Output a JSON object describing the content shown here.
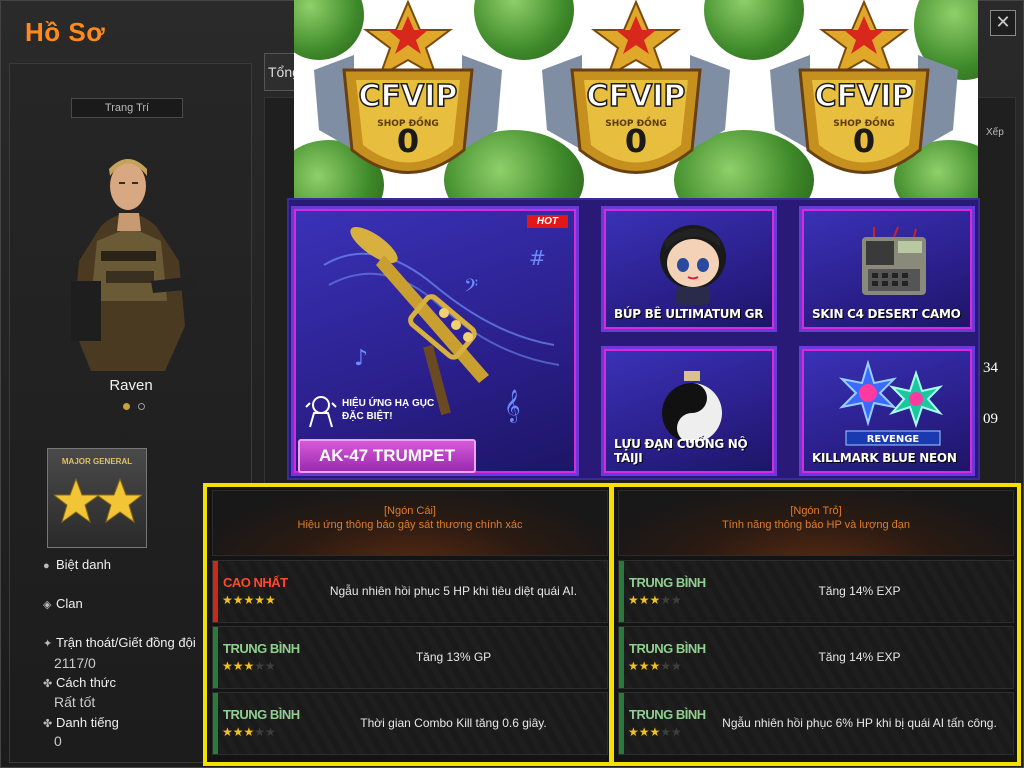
{
  "window": {
    "title": "Hồ Sơ",
    "close_icon": "close-icon"
  },
  "profile": {
    "decor_label": "Trang Trí",
    "name": "Raven",
    "rank": "MAJOR GENERAL",
    "stats": [
      {
        "label": "Biệt danh",
        "value": "",
        "icon": "person-icon"
      },
      {
        "label": "Clan",
        "value": "",
        "icon": "shield-icon"
      },
      {
        "label": "Trận thoát/Giết đồng đội",
        "value": "2117/0",
        "icon": "running-icon"
      },
      {
        "label": "Cách thức",
        "value": "Rất tốt",
        "icon": "clover-icon"
      },
      {
        "label": "Danh tiếng",
        "value": "0",
        "icon": "clover-icon"
      }
    ]
  },
  "tabs": {
    "tong": "Tổng"
  },
  "side": {
    "xep": "Xếp",
    "num1": "34",
    "num2": "09"
  },
  "vip": {
    "badge_text": "CFVIP",
    "badge_number": "0",
    "ribbon": "SHOP ĐỒNG"
  },
  "shop": {
    "hot": "HOT",
    "main_item": "AK-47 TRUMPET",
    "effect": "HIỆU ỨNG HẠ GỤC\nĐẶC BIỆT!",
    "items": [
      "BÚP BÊ ULTIMATUM GR",
      "SKIN C4 DESERT CAMO",
      "LỰU ĐẠN CUỒNG NỘ TAIJI",
      "KILLMARK BLUE NEON"
    ],
    "revenge": "REVENGE"
  },
  "effects": {
    "left": {
      "kind": "[Ngón Cái]",
      "desc": "Hiệu ứng thông báo gây sát thương chính xác",
      "rows": [
        {
          "tier": "CAO NHẤT",
          "stars": 5,
          "text": "Ngẫu nhiên hồi phục 5 HP khi tiêu diệt quái AI."
        },
        {
          "tier": "TRUNG BÌNH",
          "stars": 3,
          "text": "Tăng 13% GP"
        },
        {
          "tier": "TRUNG BÌNH",
          "stars": 3,
          "text": "Thời gian Combo Kill tăng 0.6 giây."
        }
      ]
    },
    "right": {
      "kind": "[Ngón Trỏ]",
      "desc": "Tính năng thông báo HP và lượng đạn",
      "rows": [
        {
          "tier": "TRUNG BÌNH",
          "stars": 3,
          "text": "Tăng 14% EXP"
        },
        {
          "tier": "TRUNG BÌNH",
          "stars": 3,
          "text": "Tăng 14% EXP"
        },
        {
          "tier": "TRUNG BÌNH",
          "stars": 3,
          "text": "Ngẫu nhiên hồi phục 6% HP khi bị quái AI tấn công."
        }
      ]
    },
    "colors": {
      "highlight": "#f5e100",
      "top_tier": "#e03a2a",
      "mid_tier": "#8fd08f",
      "star": "#f3c21a"
    }
  }
}
